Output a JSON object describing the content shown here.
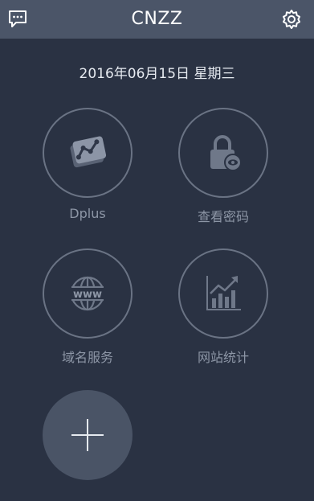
{
  "header": {
    "title": "CNZZ"
  },
  "date_line": "2016年06月15日 星期三",
  "tiles": [
    {
      "label": "Dplus",
      "icon": "dplus-chart-icon"
    },
    {
      "label": "查看密码",
      "icon": "lock-eye-icon"
    },
    {
      "label": "域名服务",
      "icon": "globe-www-icon"
    },
    {
      "label": "网站统计",
      "icon": "trend-chart-icon"
    }
  ],
  "add_button": {
    "icon": "plus-icon"
  },
  "colors": {
    "background": "#2a3243",
    "header": "#4b5568",
    "icon": "#6f7889",
    "label": "#8d96a6"
  }
}
